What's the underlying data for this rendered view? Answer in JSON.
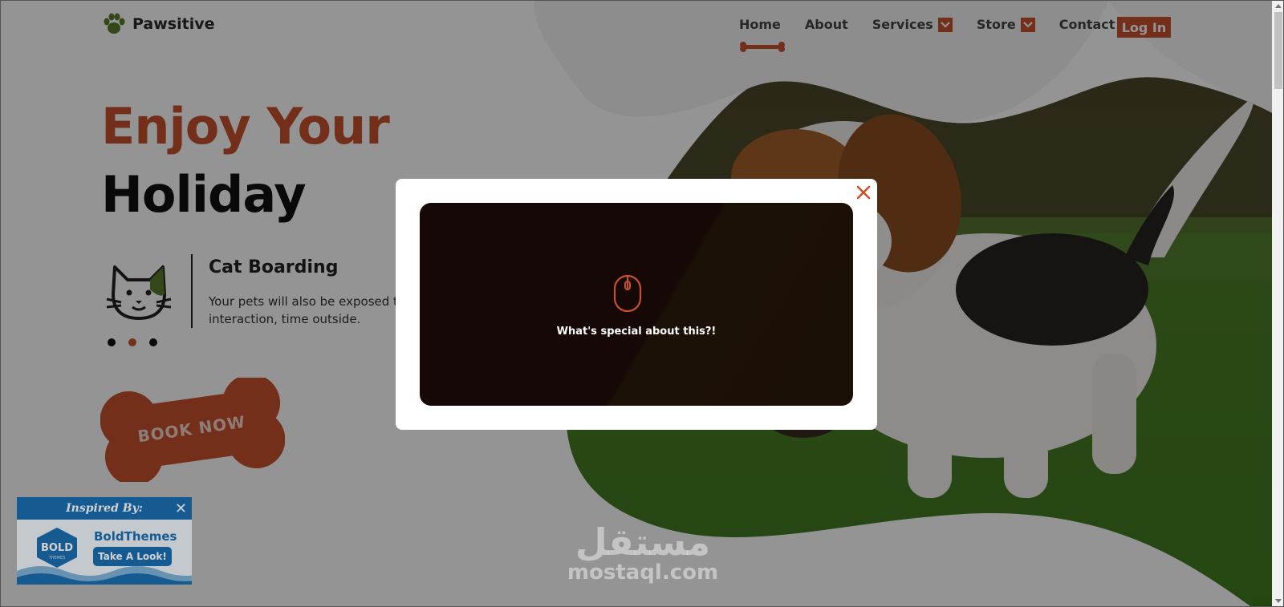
{
  "brand": {
    "name": "Pawsitive",
    "accent_color": "#c8512d",
    "logo_icon": "paw-icon"
  },
  "nav": {
    "items": [
      {
        "label": "Home",
        "active": true
      },
      {
        "label": "About"
      },
      {
        "label": "Services",
        "has_dropdown": true
      },
      {
        "label": "Store",
        "has_dropdown": true
      },
      {
        "label": "Contact"
      }
    ],
    "login_label": "Log In"
  },
  "hero": {
    "title_line_1": "Enjoy Your",
    "title_line_2": "Holiday",
    "service": {
      "icon": "cat-face-icon",
      "title": "Cat Boarding",
      "description": "Your pets will also be exposed to interaction, time outside."
    },
    "slider": {
      "total": 3,
      "active_index": 1
    },
    "cta_label": "BOOK NOW"
  },
  "modal": {
    "video_icon": "mouse-icon",
    "caption": "What's special about this?!"
  },
  "inspired_card": {
    "heading": "Inspired By:",
    "badge_text": "BOLD",
    "badge_subtext": "THEMES",
    "company": "BoldThemes",
    "button_label": "Take A Look!"
  },
  "watermark": {
    "arabic": "مستقل",
    "latin": "mostaql.com"
  }
}
